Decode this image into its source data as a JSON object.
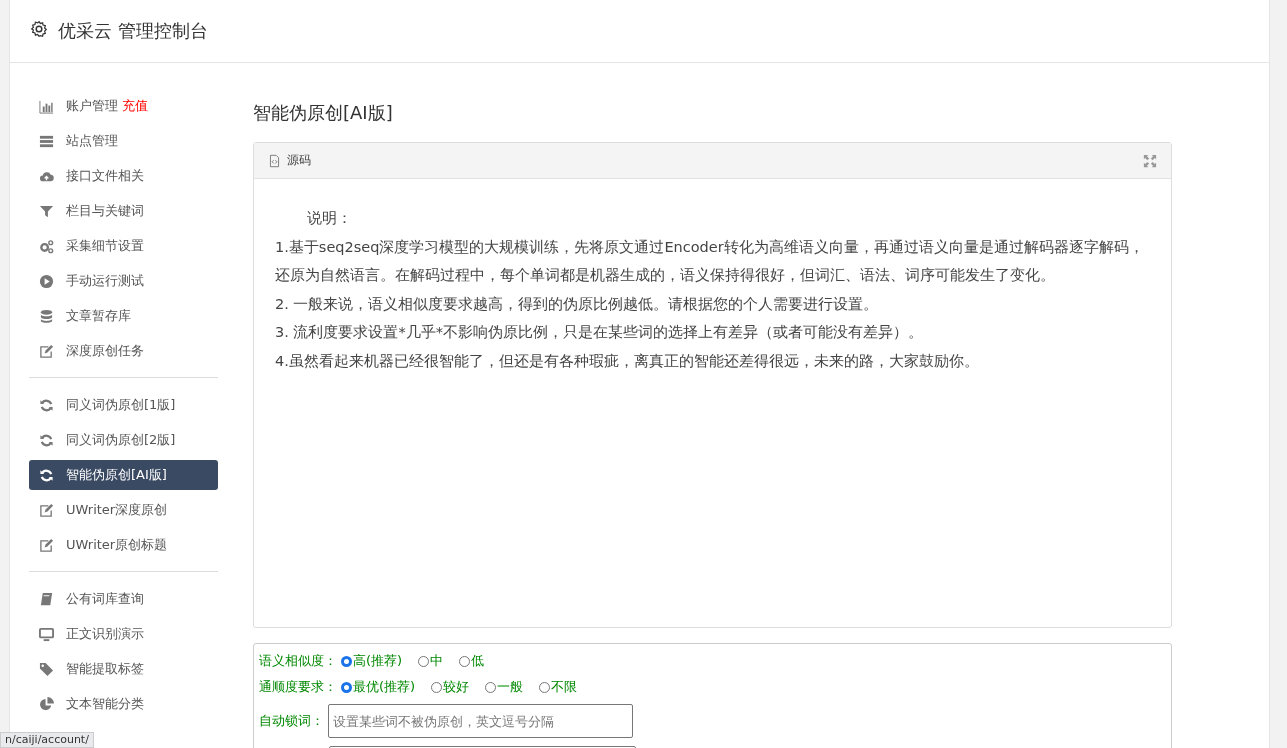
{
  "header": {
    "title": "优采云 管理控制台"
  },
  "sidebar": {
    "groups": [
      [
        {
          "label": "账户管理",
          "badge": "充值",
          "selected": false
        },
        {
          "label": "站点管理",
          "selected": false
        },
        {
          "label": "接口文件相关",
          "selected": false
        },
        {
          "label": "栏目与关键词",
          "selected": false
        },
        {
          "label": "采集细节设置",
          "selected": false
        },
        {
          "label": "手动运行测试",
          "selected": false
        },
        {
          "label": "文章暂存库",
          "selected": false
        },
        {
          "label": "深度原创任务",
          "selected": false
        }
      ],
      [
        {
          "label": "同义词伪原创[1版]",
          "selected": false
        },
        {
          "label": "同义词伪原创[2版]",
          "selected": false
        },
        {
          "label": "智能伪原创[AI版]",
          "selected": true
        },
        {
          "label": "UWriter深度原创",
          "selected": false
        },
        {
          "label": "UWriter原创标题",
          "selected": false
        }
      ],
      [
        {
          "label": "公有词库查询",
          "selected": false
        },
        {
          "label": "正文识别演示",
          "selected": false
        },
        {
          "label": "智能提取标签",
          "selected": false
        },
        {
          "label": "文本智能分类",
          "selected": false
        }
      ]
    ]
  },
  "page_title": "智能伪原创[AI版]",
  "editor": {
    "toolbar_label": "源码",
    "heading": "说明：",
    "paragraphs": [
      "1.基于seq2seq深度学习模型的大规模训练，先将原文通过Encoder转化为高维语义向量，再通过语义向量是通过解码器逐字解码，还原为自然语言。在解码过程中，每个单词都是机器生成的，语义保持得很好，但词汇、语法、词序可能发生了变化。",
      "2. 一般来说，语义相似度要求越高，得到的伪原比例越低。请根据您的个人需要进行设置。",
      "3. 流利度要求设置*几乎*不影响伪原比例，只是在某些词的选择上有差异（或者可能没有差异）。",
      "4.虽然看起来机器已经很智能了，但还是有各种瑕疵，离真正的智能还差得很远，未来的路，大家鼓励你。"
    ]
  },
  "options": {
    "radio_groups": [
      {
        "label": "语义相似度：",
        "options": [
          {
            "label": "高(推荐)",
            "selected": true
          },
          {
            "label": "中",
            "selected": false
          },
          {
            "label": "低",
            "selected": false
          }
        ]
      },
      {
        "label": "通顺度要求：",
        "options": [
          {
            "label": "最优(推荐)",
            "selected": true
          },
          {
            "label": "较好",
            "selected": false
          },
          {
            "label": "一般",
            "selected": false
          },
          {
            "label": "不限",
            "selected": false
          }
        ]
      }
    ],
    "lock_words": {
      "label": "自动锁词：",
      "placeholder": "设置某些词不被伪原创，英文逗号分隔"
    }
  },
  "status_url": "n/caiji/account/"
}
